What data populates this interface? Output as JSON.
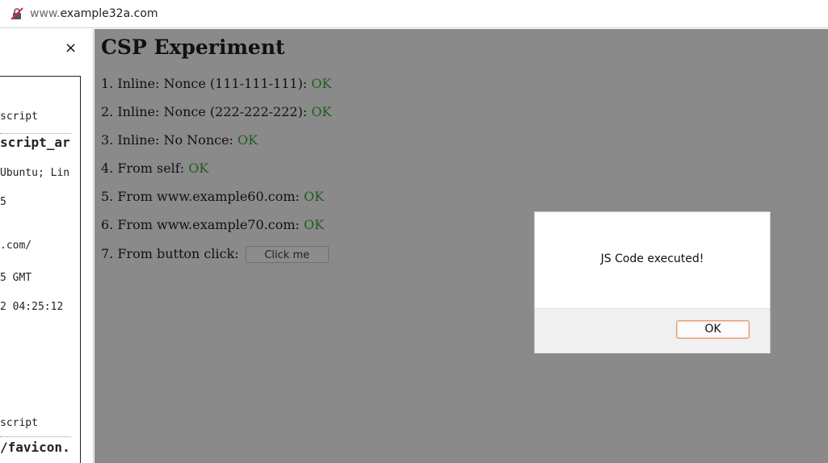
{
  "urlbar": {
    "url_prefix": "www.",
    "url_host": "example32a.com"
  },
  "sidepanel": {
    "close_label": "×",
    "lines": [
      "script",
      "script_ar",
      "Ubuntu; Lin",
      "5",
      ".com/",
      "5 GMT",
      "2 04:25:12",
      "script",
      "/favicon."
    ]
  },
  "page": {
    "title": "CSP Experiment",
    "rows": [
      {
        "label": "1. Inline: Nonce (111-111-111): ",
        "status": "OK"
      },
      {
        "label": "2. Inline: Nonce (222-222-222): ",
        "status": "OK"
      },
      {
        "label": "3. Inline: No Nonce: ",
        "status": "OK"
      },
      {
        "label": "4. From self: ",
        "status": "OK"
      },
      {
        "label": "5. From www.example60.com: ",
        "status": "OK"
      },
      {
        "label": "6. From www.example70.com: ",
        "status": "OK"
      }
    ],
    "button_row_label": "7. From button click: ",
    "button_label": "Click me"
  },
  "dialog": {
    "message": "JS Code executed!",
    "ok_label": "OK"
  },
  "colors": {
    "ok_green": "#1f5f1f",
    "overlay_gray": "#8a8a8a",
    "dialog_button_border": "#e39a6b"
  }
}
